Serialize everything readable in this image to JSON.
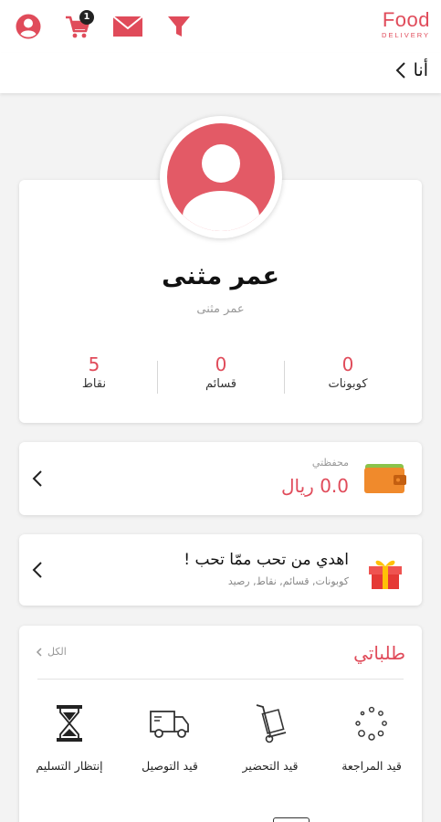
{
  "header": {
    "cart_count": "1",
    "logo_word": "Food",
    "logo_sub": "DELIVERY",
    "back_label": "أنا"
  },
  "profile": {
    "name": "عمر مثنى",
    "username": "عمر مثنى",
    "stats": [
      {
        "value": "0",
        "label": "كوبونات"
      },
      {
        "value": "0",
        "label": "قسائم"
      },
      {
        "value": "5",
        "label": "نقاط"
      }
    ]
  },
  "wallet": {
    "caption": "محفظتي",
    "amount": "0.0 ريال"
  },
  "gift": {
    "title": "اهدي من تحب ممّا تحب !",
    "subtitle": "كوبونات, قسائم, نقاط, رصيد"
  },
  "orders": {
    "title": "طلباتي",
    "see_all": "الكل",
    "statuses": [
      {
        "label": "قيد المراجعة",
        "icon": "loading-dots-icon"
      },
      {
        "label": "قيد التحضير",
        "icon": "hand-truck-icon"
      },
      {
        "label": "قيد التوصيل",
        "icon": "delivery-truck-icon"
      },
      {
        "label": "إنتظار التسليم",
        "icon": "hourglass-icon"
      }
    ]
  },
  "colors": {
    "accent": "#e04b5a",
    "avatar": "#e35a66",
    "wallet": "#f08a2c",
    "gift": "#e53935"
  }
}
